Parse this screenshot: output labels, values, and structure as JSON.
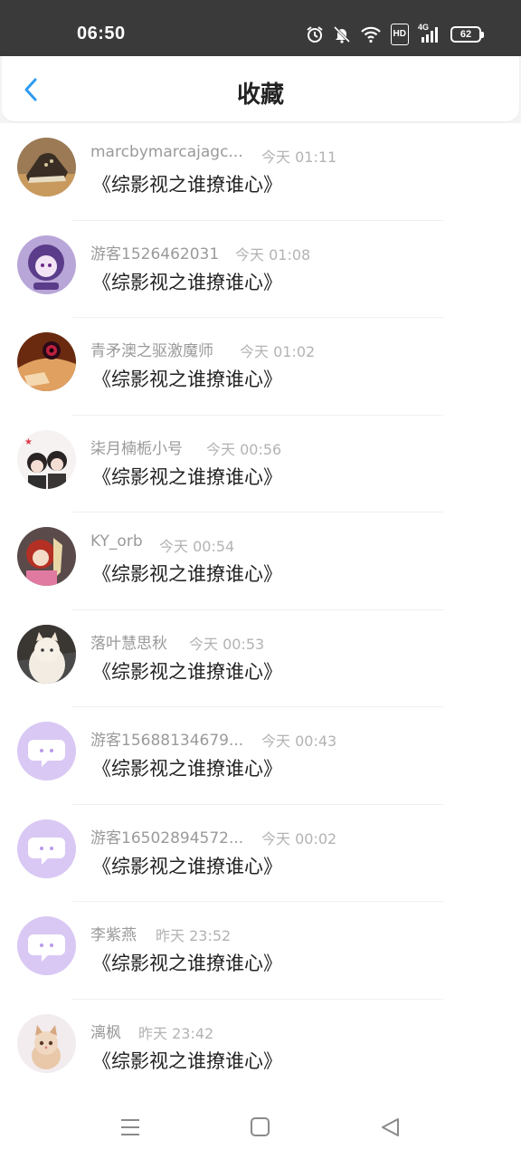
{
  "status_bar": {
    "time": "06:50",
    "hd_label": "HD",
    "network_label": "4G",
    "battery": "62"
  },
  "header": {
    "title": "收藏",
    "back_icon": "chevron-left-icon",
    "accent_color": "#2f9bf0"
  },
  "items": [
    {
      "name": "marcbymarcajagc...",
      "time": "今天 01:11",
      "content": "《综影视之谁撩谁心》",
      "avatar": "sneaker-photo"
    },
    {
      "name": "游客1526462031",
      "time": "今天 01:08",
      "content": "《综影视之谁撩谁心》",
      "avatar": "anime-purple-girl"
    },
    {
      "name": "青矛澳之驱激魔师",
      "time": "今天 01:02",
      "content": "《综影视之谁撩谁心》",
      "avatar": "anime-eye-art"
    },
    {
      "name": "柒月楠栀小号",
      "time": "今天 00:56",
      "content": "《综影视之谁撩谁心》",
      "avatar": "anime-couple"
    },
    {
      "name": "KY_orb",
      "time": "今天 00:54",
      "content": "《综影视之谁撩谁心》",
      "avatar": "anime-red-hair"
    },
    {
      "name": "落叶慧思秋",
      "time": "今天 00:53",
      "content": "《综影视之谁撩谁心》",
      "avatar": "white-cat-photo"
    },
    {
      "name": "游客15688134679...",
      "time": "今天 00:43",
      "content": "《综影视之谁撩谁心》",
      "avatar": "default-chat-bubble"
    },
    {
      "name": "游客16502894572...",
      "time": "今天 00:02",
      "content": "《综影视之谁撩谁心》",
      "avatar": "default-chat-bubble"
    },
    {
      "name": "李紫燕",
      "time": "昨天 23:52",
      "content": "《综影视之谁撩谁心》",
      "avatar": "default-chat-bubble"
    },
    {
      "name": "漓枫",
      "time": "昨天 23:42",
      "content": "《综影视之谁撩谁心》",
      "avatar": "kitten-photo"
    }
  ]
}
